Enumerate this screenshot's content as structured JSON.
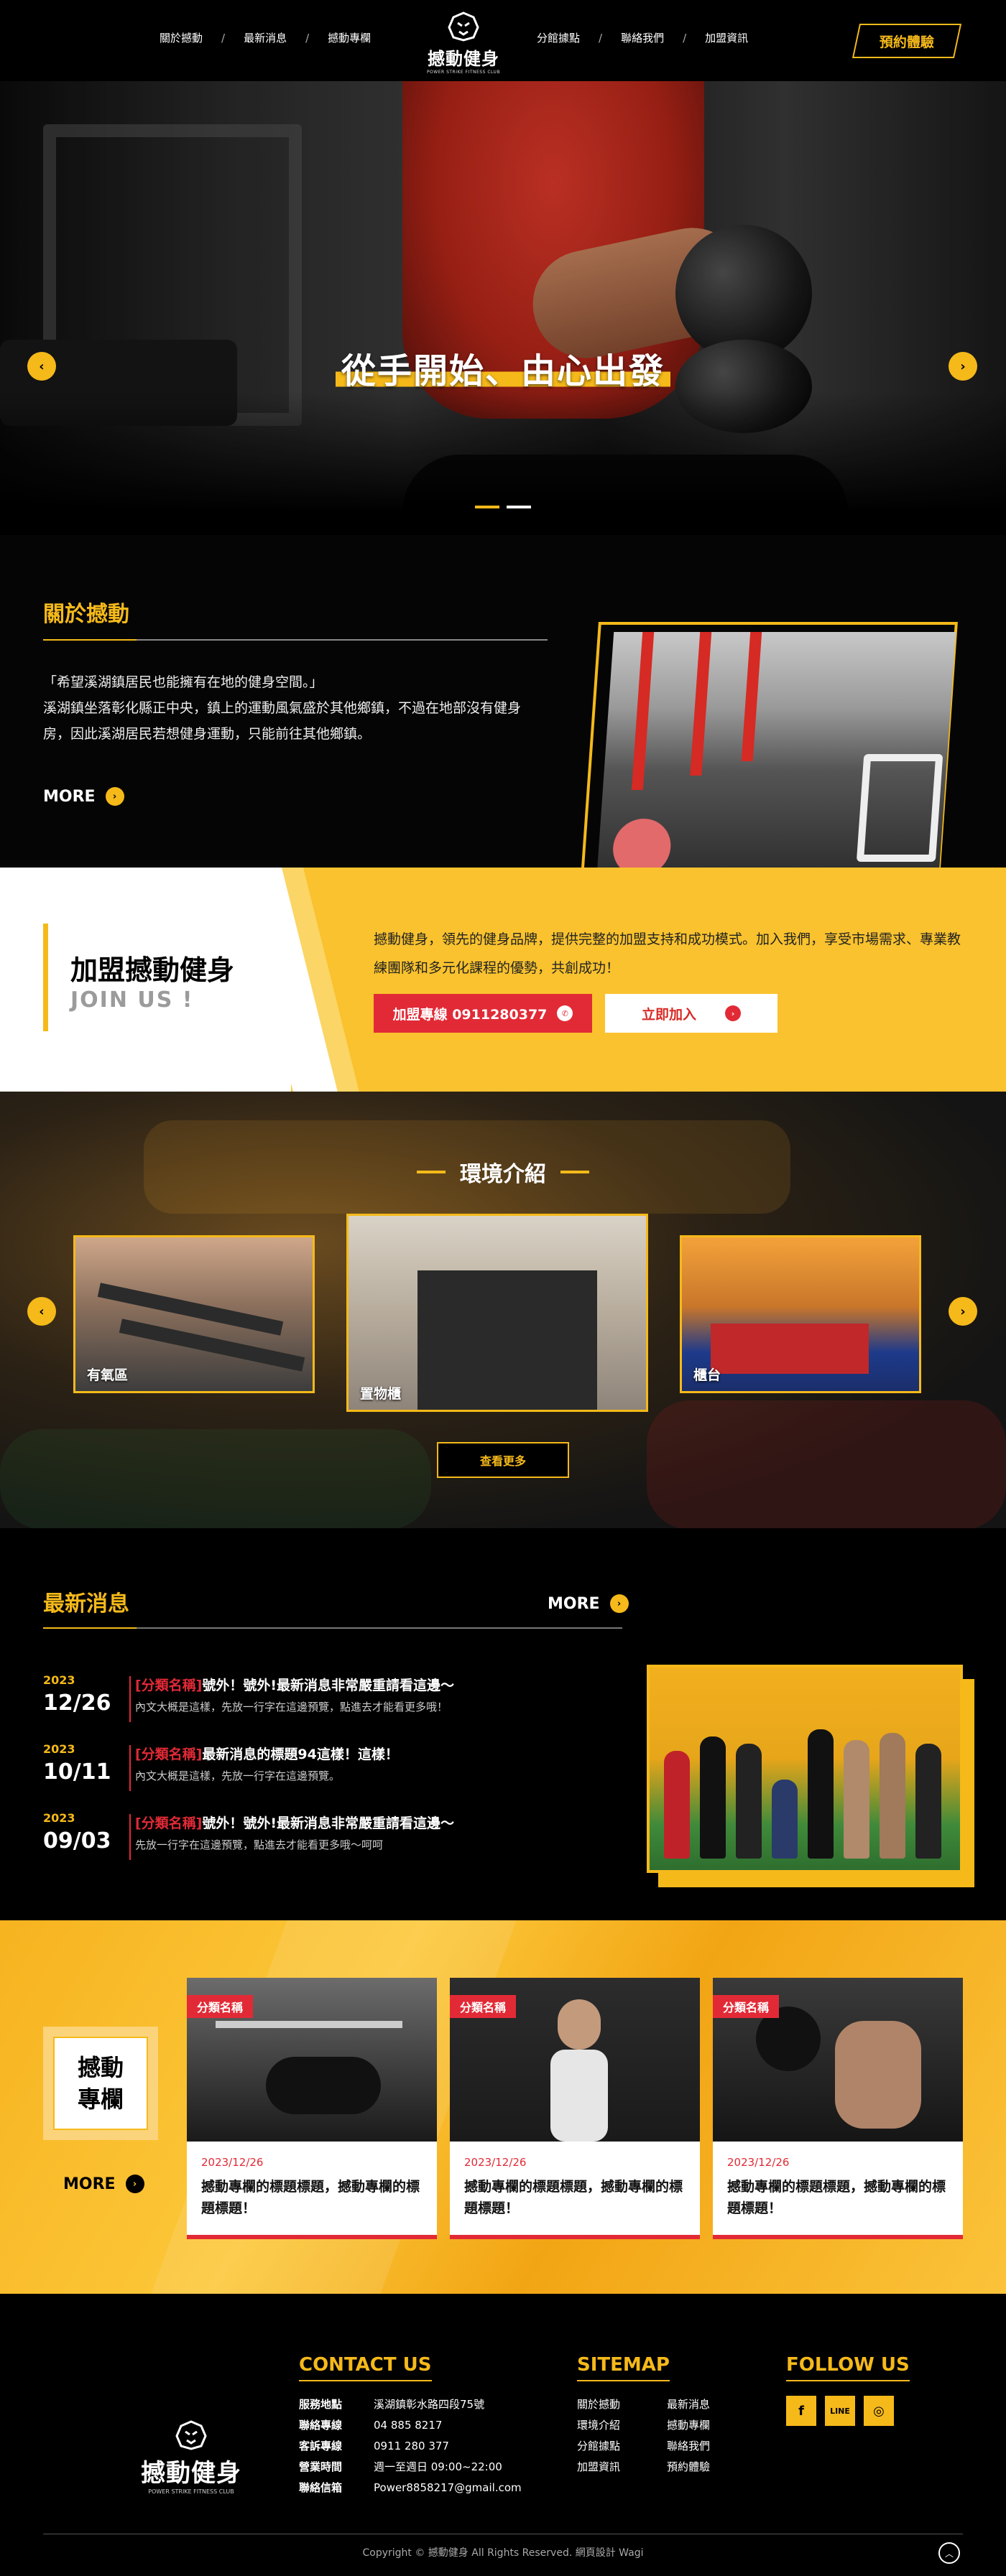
{
  "header": {
    "nav_left": [
      "關於撼動",
      "最新消息",
      "撼動專欄"
    ],
    "nav_right": [
      "分館據點",
      "聯絡我們",
      "加盟資訊"
    ],
    "logo_name": "撼動健身",
    "logo_sub": "POWER STRIKE FITNESS CLUB",
    "book_label": "預約體驗"
  },
  "hero": {
    "title": "從手開始、由心出發",
    "prev": "‹",
    "next": "›",
    "slide_count": 2,
    "active_slide": 1
  },
  "about": {
    "title": "關於撼動",
    "quote": "「希望溪湖鎮居民也能擁有在地的健身空間。」",
    "body": "溪湖鎮坐落彰化縣正中央，鎮上的運動風氣盛於其他鄉鎮，不過在地部沒有健身房，因此溪湖居民若想健身運動，只能前往其他鄉鎮。",
    "more": "MORE"
  },
  "join": {
    "title": "加盟撼動健身",
    "subtitle": "JOIN US !",
    "desc": "撼動健身，領先的健身品牌，提供完整的加盟支持和成功模式。加入我們，享受市場需求、專業教練團隊和多元化課程的優勢，共創成功！",
    "phone_label": "加盟專線 0911280377",
    "join_label": "立即加入"
  },
  "environment": {
    "title": "環境介紹",
    "cards": [
      "有氧區",
      "置物櫃",
      "櫃台"
    ],
    "more": "查看更多"
  },
  "news": {
    "title": "最新消息",
    "more": "MORE",
    "items": [
      {
        "year": "2023",
        "date": "12/26",
        "category": "[分類名稱]",
        "title": "號外！號外!最新消息非常嚴重請看這邊～",
        "summary": "內文大概是這樣，先放一行字在這邊預覽，點進去才能看更多哦！"
      },
      {
        "year": "2023",
        "date": "10/11",
        "category": "[分類名稱]",
        "title": "最新消息的標題94這樣！這樣！",
        "summary": "內文大概是這樣，先放一行字在這邊預覽。"
      },
      {
        "year": "2023",
        "date": "09/03",
        "category": "[分類名稱]",
        "title": "號外！號外!最新消息非常嚴重請看這邊～",
        "summary": "先放一行字在這邊預覽，點進去才能看更多哦～呵呵"
      }
    ]
  },
  "column": {
    "title_line1": "撼動",
    "title_line2": "專欄",
    "more": "MORE",
    "articles": [
      {
        "tag": "分類名稱",
        "date": "2023/12/26",
        "title": "撼動專欄的標題標題，撼動專欄的標題標題！"
      },
      {
        "tag": "分類名稱",
        "date": "2023/12/26",
        "title": "撼動專欄的標題標題，撼動專欄的標題標題！"
      },
      {
        "tag": "分類名稱",
        "date": "2023/12/26",
        "title": "撼動專欄的標題標題，撼動專欄的標題標題！"
      }
    ]
  },
  "footer": {
    "logo_name": "撼動健身",
    "logo_sub": "POWER STRIKE FITNESS CLUB",
    "contact_title": "CONTACT US",
    "contact": [
      {
        "k": "服務地點",
        "v": "溪湖鎮彰水路四段75號"
      },
      {
        "k": "聯絡專線",
        "v": "04 885 8217"
      },
      {
        "k": "客訴專線",
        "v": "0911 280 377"
      },
      {
        "k": "營業時間",
        "v": "週一至週日 09:00~22:00"
      },
      {
        "k": "聯絡信箱",
        "v": "Power8858217@gmail.com"
      }
    ],
    "sitemap_title": "SITEMAP",
    "sitemap_col1": [
      "關於撼動",
      "環境介紹",
      "分館據點",
      "加盟資訊"
    ],
    "sitemap_col2": [
      "最新消息",
      "撼動專欄",
      "聯絡我們",
      "預約體驗"
    ],
    "follow_title": "FOLLOW US",
    "social": [
      "f",
      "LINE",
      "◎"
    ],
    "copyright": "Copyright © 撼動健身 All Rights Reserved. 網頁設計 Wagi"
  },
  "colors": {
    "accent": "#f5b91a",
    "red": "#e22a36",
    "background": "#000000"
  }
}
